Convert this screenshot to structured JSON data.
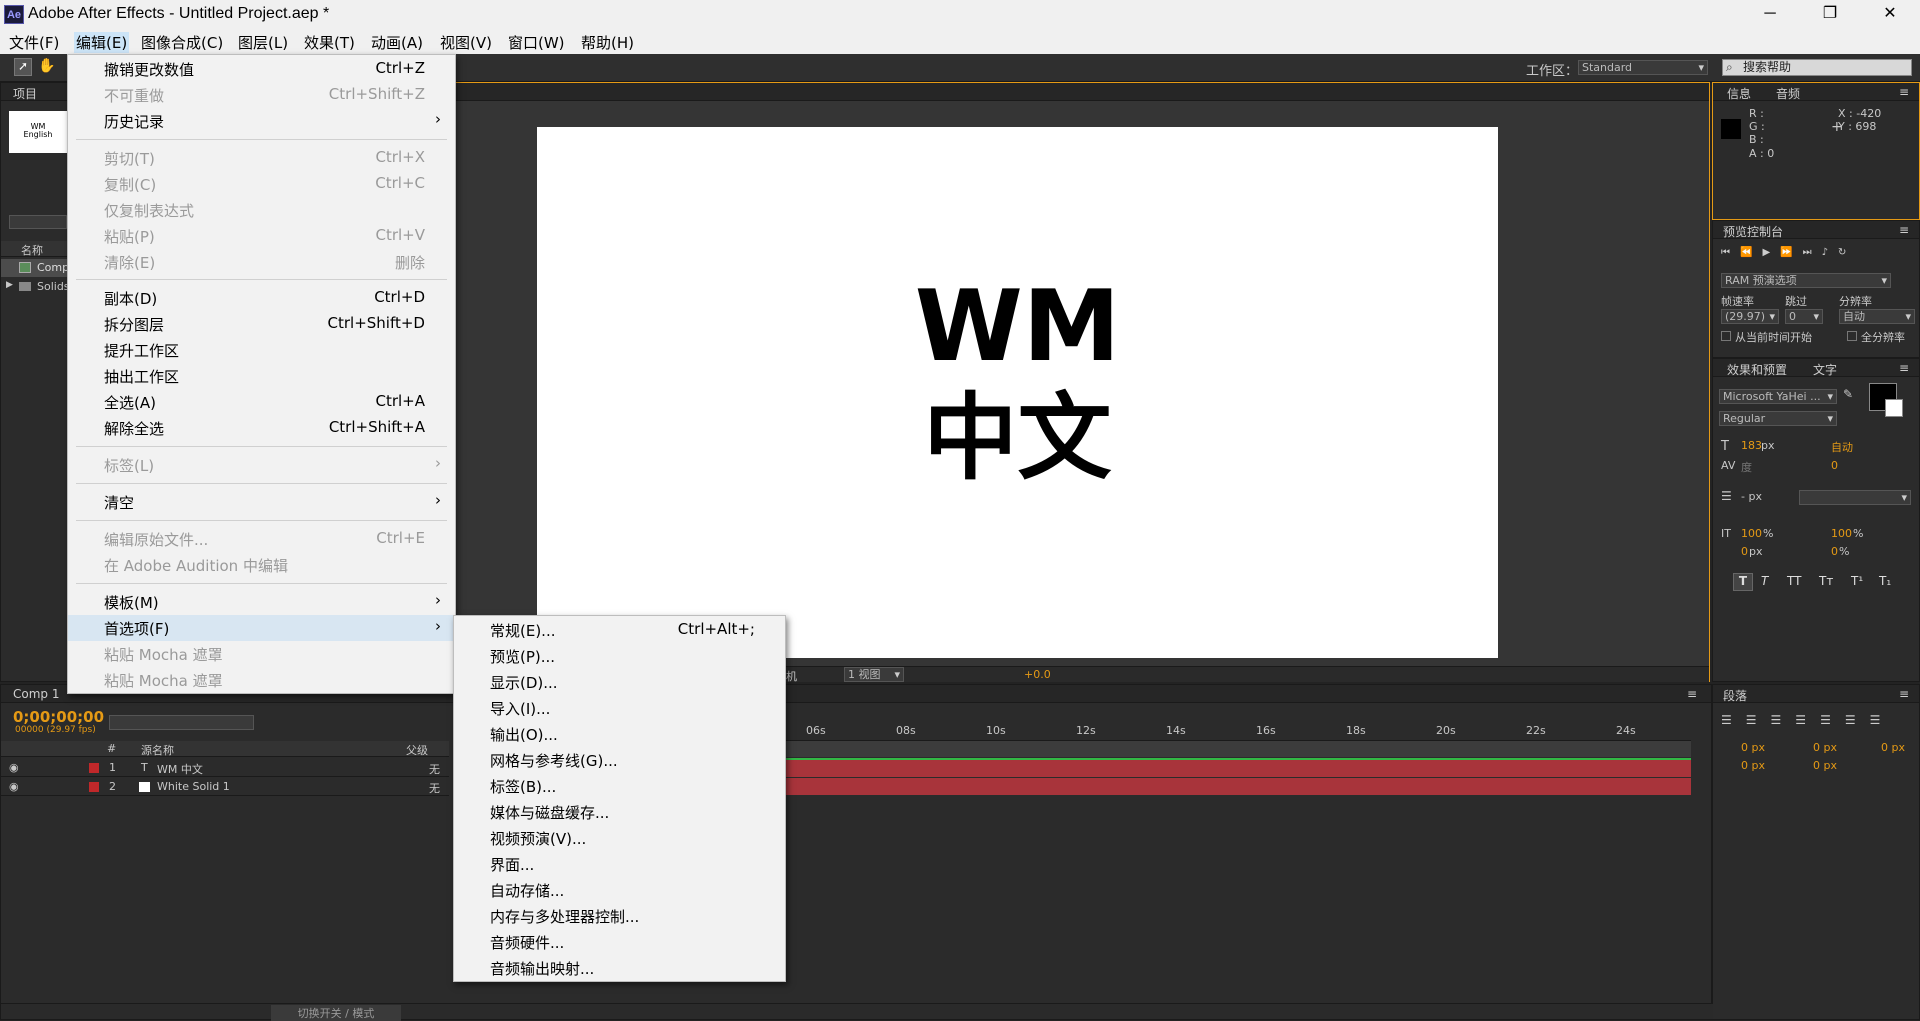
{
  "app": {
    "logo_text": "Ae",
    "title": "Adobe After Effects - Untitled Project.aep *",
    "minimize_icon": "─",
    "maximize_icon": "❐",
    "close_icon": "✕"
  },
  "menubar": {
    "items": [
      "文件(F)",
      "编辑(E)",
      "图像合成(C)",
      "图层(L)",
      "效果(T)",
      "动画(A)",
      "视图(V)",
      "窗口(W)",
      "帮助(H)"
    ]
  },
  "toolbar": {
    "workspace_label": "工作区：",
    "workspace_value": "Standard",
    "search_placeholder": "搜索帮助"
  },
  "edit_menu": {
    "items": [
      {
        "label": "撤销更改数值",
        "shortcut": "Ctrl+Z",
        "disabled": false
      },
      {
        "label": "不可重做",
        "shortcut": "Ctrl+Shift+Z",
        "disabled": true
      },
      {
        "label": "历史记录",
        "shortcut": "",
        "disabled": false,
        "submenu": true
      },
      {
        "label": "剪切(T)",
        "shortcut": "Ctrl+X",
        "disabled": true
      },
      {
        "label": "复制(C)",
        "shortcut": "Ctrl+C",
        "disabled": true
      },
      {
        "label": "仅复制表达式",
        "shortcut": "",
        "disabled": true
      },
      {
        "label": "粘贴(P)",
        "shortcut": "Ctrl+V",
        "disabled": true
      },
      {
        "label": "清除(E)",
        "shortcut": "删除",
        "disabled": true
      },
      {
        "label": "副本(D)",
        "shortcut": "Ctrl+D",
        "disabled": false
      },
      {
        "label": "拆分图层",
        "shortcut": "Ctrl+Shift+D",
        "disabled": false
      },
      {
        "label": "提升工作区",
        "shortcut": "",
        "disabled": false
      },
      {
        "label": "抽出工作区",
        "shortcut": "",
        "disabled": false
      },
      {
        "label": "全选(A)",
        "shortcut": "Ctrl+A",
        "disabled": false
      },
      {
        "label": "解除全选",
        "shortcut": "Ctrl+Shift+A",
        "disabled": false
      },
      {
        "label": "标签(L)",
        "shortcut": "",
        "disabled": true,
        "submenu": true
      },
      {
        "label": "清空",
        "shortcut": "",
        "disabled": false,
        "submenu": true
      },
      {
        "label": "编辑原始文件...",
        "shortcut": "Ctrl+E",
        "disabled": true
      },
      {
        "label": "在 Adobe Audition 中编辑",
        "shortcut": "",
        "disabled": true
      },
      {
        "label": "模板(M)",
        "shortcut": "",
        "disabled": false,
        "submenu": true
      },
      {
        "label": "首选项(F)",
        "shortcut": "",
        "disabled": false,
        "submenu": true,
        "highlighted": true
      },
      {
        "label": "粘贴 Mocha 遮罩",
        "shortcut": "",
        "disabled": true
      },
      {
        "label": "粘贴 Mocha 遮罩",
        "shortcut": "",
        "disabled": true
      }
    ]
  },
  "prefs_menu": {
    "items": [
      {
        "label": "常规(E)...",
        "shortcut": "Ctrl+Alt+;"
      },
      {
        "label": "预览(P)...",
        "shortcut": ""
      },
      {
        "label": "显示(D)...",
        "shortcut": ""
      },
      {
        "label": "导入(I)...",
        "shortcut": ""
      },
      {
        "label": "输出(O)...",
        "shortcut": ""
      },
      {
        "label": "网格与参考线(G)...",
        "shortcut": ""
      },
      {
        "label": "标签(B)...",
        "shortcut": ""
      },
      {
        "label": "媒体与磁盘缓存...",
        "shortcut": ""
      },
      {
        "label": "视频预演(V)...",
        "shortcut": ""
      },
      {
        "label": "界面...",
        "shortcut": ""
      },
      {
        "label": "自动存储...",
        "shortcut": ""
      },
      {
        "label": "内存与多处理器控制...",
        "shortcut": ""
      },
      {
        "label": "音频硬件...",
        "shortcut": ""
      },
      {
        "label": "音频输出映射...",
        "shortcut": ""
      }
    ]
  },
  "project_panel": {
    "tab": "项目",
    "thumb_line1": "WM",
    "thumb_line2": "English",
    "col_name": "名称",
    "items": [
      "Comp",
      "Solids"
    ]
  },
  "composition": {
    "line1": "WM",
    "line2": "中文",
    "view_label": "1 视图",
    "camera_label": "机",
    "exposure": "+0.0"
  },
  "info_panel": {
    "tab_info": "信息",
    "tab_audio": "音频",
    "r": "R :",
    "g": "G :",
    "b": "B :",
    "a": "A : 0",
    "x": "X : -420",
    "y": "Y : 698"
  },
  "preview_panel": {
    "tab": "预览控制台",
    "ram_options": "RAM 预演选项",
    "fps_label": "帧速率",
    "skip_label": "跳过",
    "res_label": "分辨率",
    "fps_value": "(29.97)",
    "skip_value": "0",
    "res_value": "自动",
    "from_current": "从当前时间开始",
    "full_screen": "全分辨率"
  },
  "char_panel": {
    "tab_effects": "效果和预置",
    "tab_text": "文字",
    "font": "Microsoft YaHei ...",
    "style": "Regular",
    "size": "183",
    "size_unit": "px",
    "leading": "自动",
    "kerning": "度",
    "tracking": "0",
    "stroke": "- px",
    "vscale": "100",
    "hscale": "100",
    "pct": "%",
    "baseline": "0",
    "baseline_unit": "px",
    "tsume": "0",
    "tsume_unit": "%",
    "styles": [
      "T",
      "T",
      "TT",
      "Tт",
      "T¹",
      "T₁"
    ]
  },
  "paragraph_panel": {
    "tab": "段落",
    "values": [
      "0 px",
      "0 px",
      "0 px",
      "0 px",
      "0 px"
    ]
  },
  "timeline": {
    "tab": "Comp 1",
    "timecode": "0;00;00;00",
    "fps_info": "00000 (29.97 fps)",
    "col_num": "#",
    "col_source": "源名称",
    "col_parent": "父级",
    "layers": [
      {
        "num": "1",
        "name": "WM 中文",
        "color": "#c0282a",
        "parent": "无"
      },
      {
        "num": "2",
        "name": "White Solid 1",
        "color": "#c0282a",
        "parent": "无"
      }
    ],
    "ruler": [
      "06s",
      "08s",
      "10s",
      "12s",
      "14s",
      "16s",
      "18s",
      "20s",
      "22s",
      "24s"
    ],
    "toggle_label": "切换开关 / 模式"
  }
}
